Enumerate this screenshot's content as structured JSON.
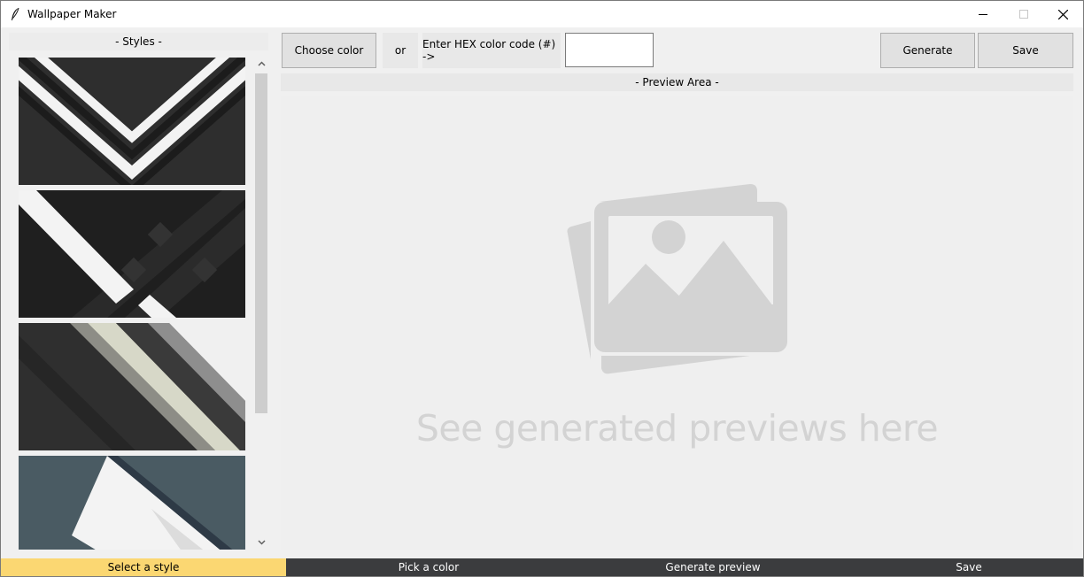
{
  "window": {
    "title": "Wallpaper Maker",
    "icon": "feather-icon",
    "controls": [
      "minimize-icon",
      "maximize-icon",
      "close-icon"
    ]
  },
  "styles_panel": {
    "header": "- Styles -",
    "thumbnails": [
      {
        "name": "chevron-stripes"
      },
      {
        "name": "dark-diagonal-lattice"
      },
      {
        "name": "gray-diagonal-bands"
      },
      {
        "name": "slate-geometric"
      }
    ]
  },
  "toolbar": {
    "choose_color_label": "Choose color",
    "or_label": "or",
    "hex_label": "Enter HEX color code (#) ->",
    "hex_value": "",
    "generate_label": "Generate",
    "save_label": "Save"
  },
  "preview": {
    "header": "- Preview Area -",
    "placeholder_text": "See generated previews here",
    "placeholder_icon": "image-gallery-icon"
  },
  "steps": [
    {
      "label": "Select a style",
      "active": true
    },
    {
      "label": "Pick a color",
      "active": false
    },
    {
      "label": "Generate preview",
      "active": false
    },
    {
      "label": "Save",
      "active": false
    }
  ],
  "colors": {
    "active_step": "#fbd772",
    "steps_bar": "#3b3c3e",
    "placeholder": "#d3d3d3"
  }
}
